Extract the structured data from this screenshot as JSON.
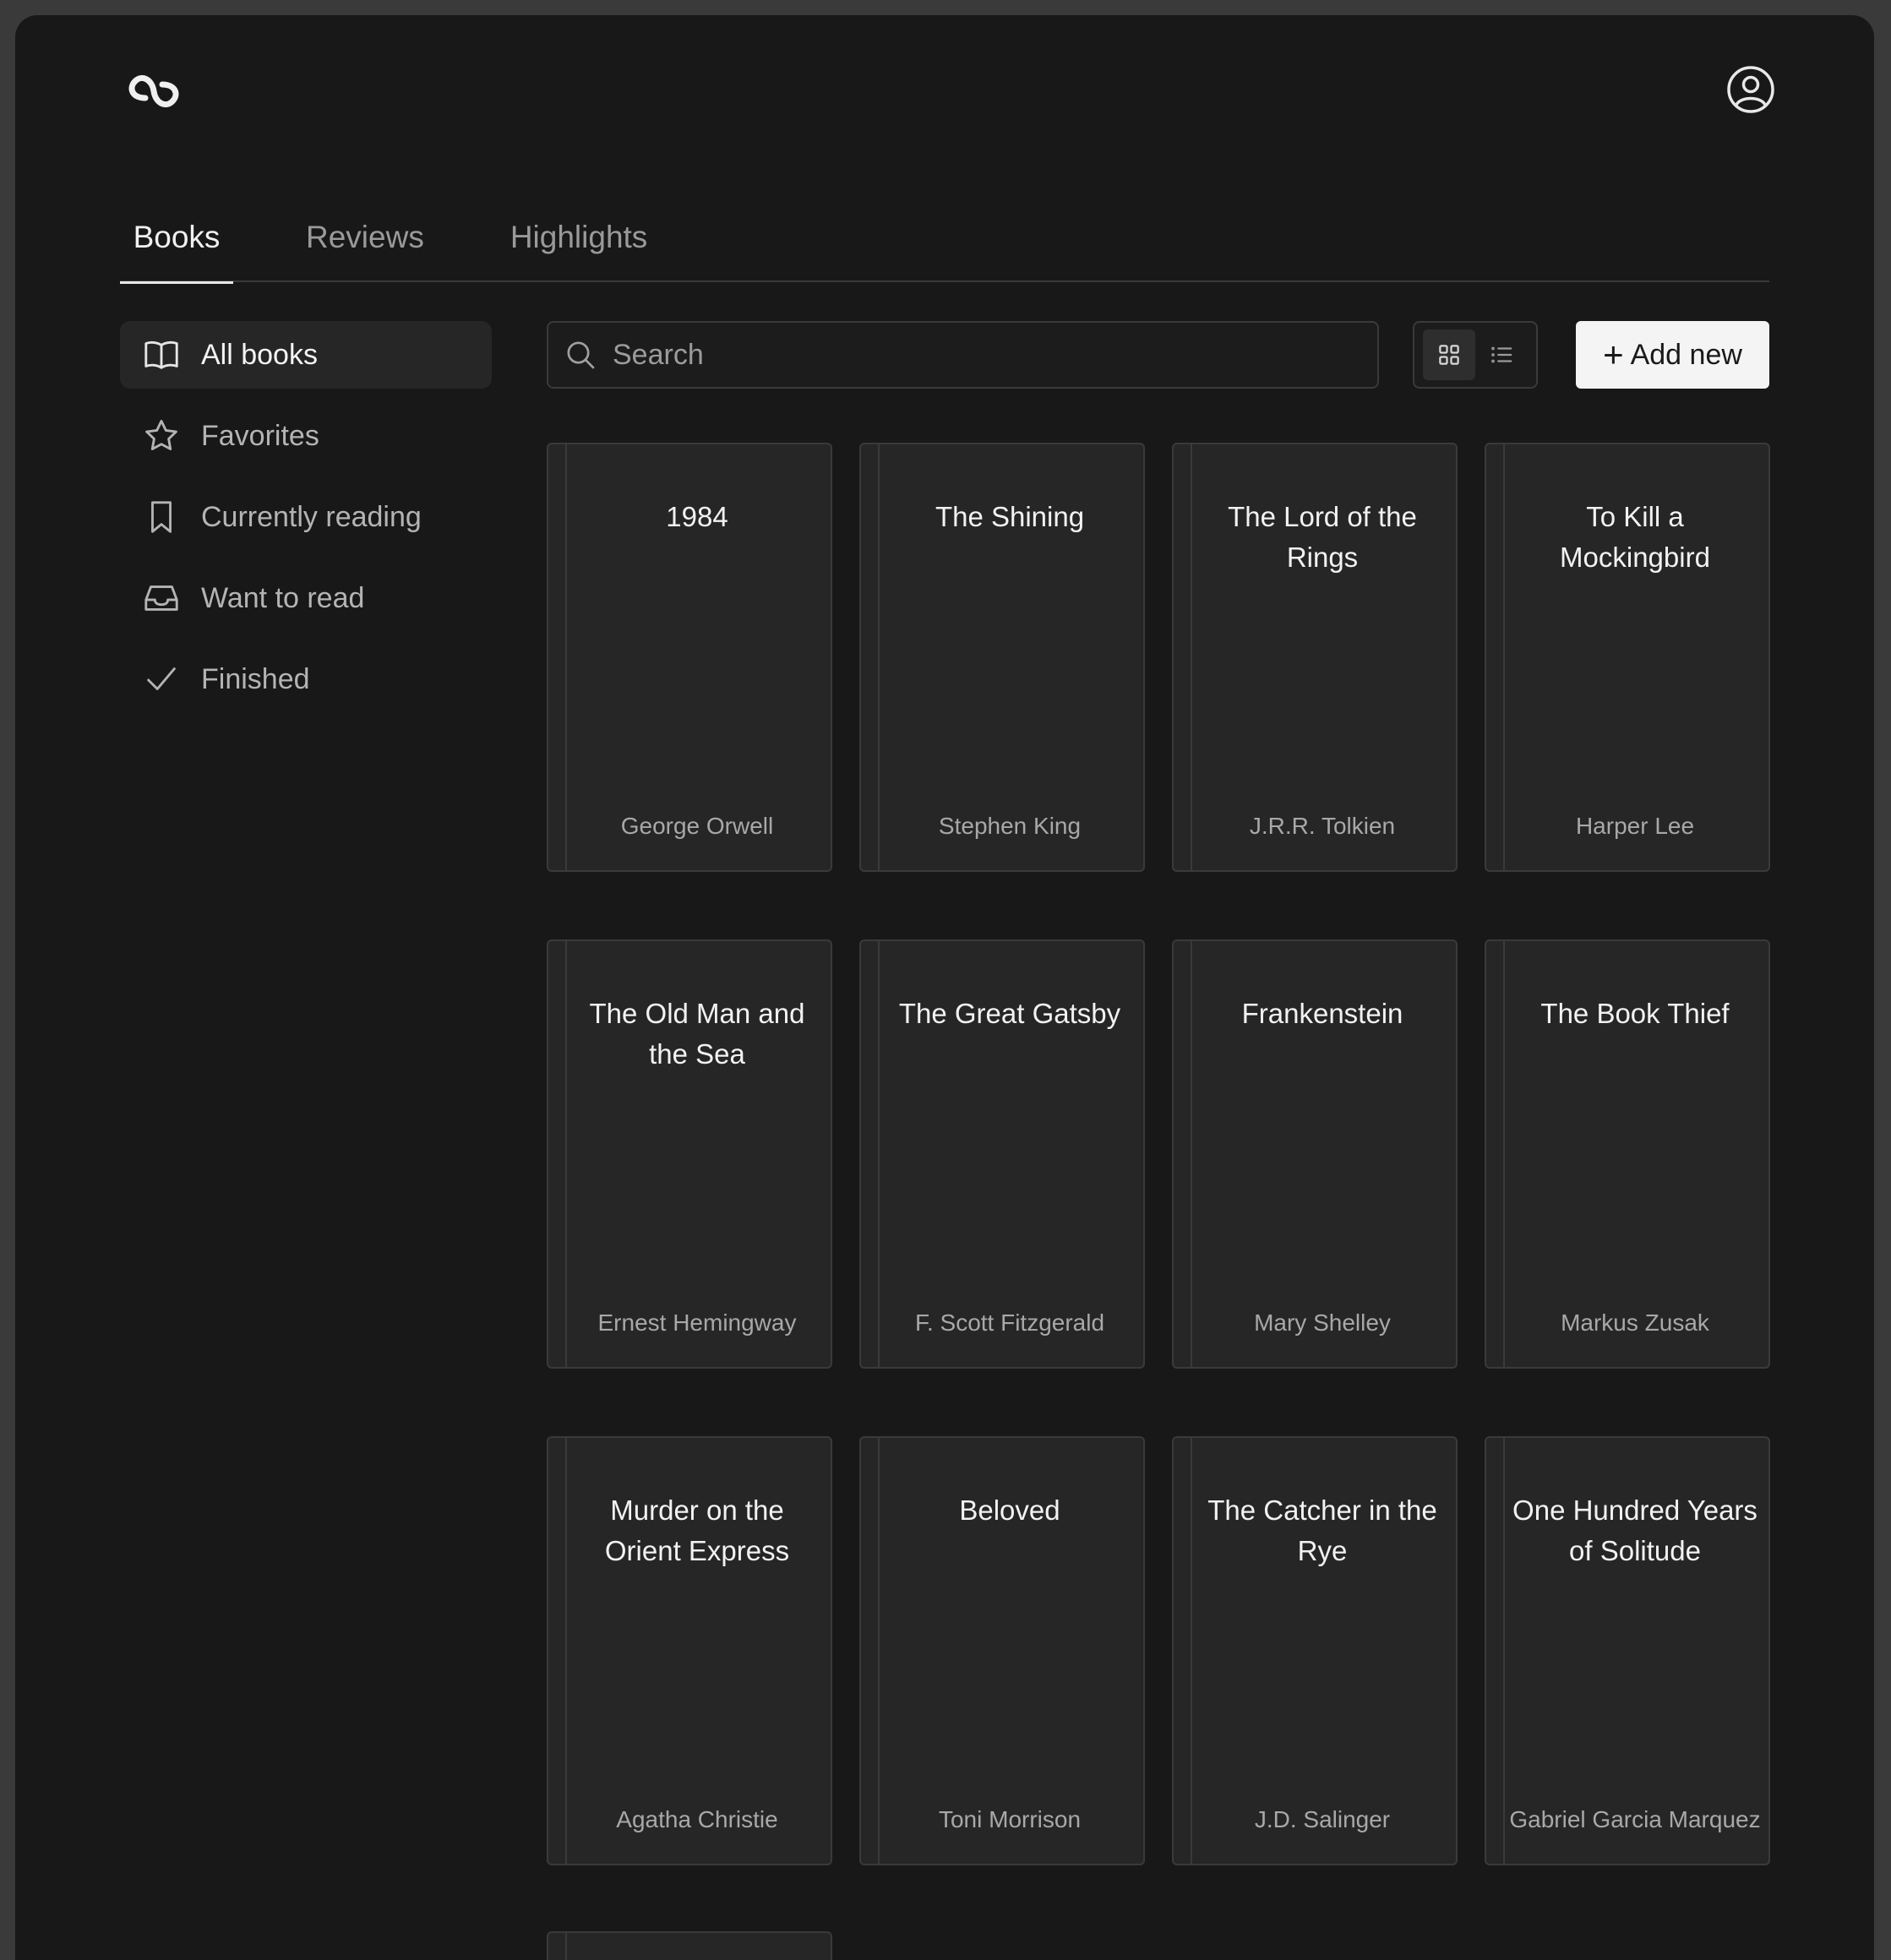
{
  "header": {
    "logo_icon": "swoosh-logo-icon",
    "account_icon": "user-circle-icon"
  },
  "tabs": [
    {
      "label": "Books",
      "active": true
    },
    {
      "label": "Reviews",
      "active": false
    },
    {
      "label": "Highlights",
      "active": false
    }
  ],
  "sidebar": {
    "items": [
      {
        "label": "All books",
        "icon": "open-book-icon",
        "active": true
      },
      {
        "label": "Favorites",
        "icon": "star-icon",
        "active": false
      },
      {
        "label": "Currently reading",
        "icon": "bookmark-icon",
        "active": false
      },
      {
        "label": "Want to read",
        "icon": "inbox-icon",
        "active": false
      },
      {
        "label": "Finished",
        "icon": "check-icon",
        "active": false
      }
    ]
  },
  "search": {
    "placeholder": "Search",
    "value": ""
  },
  "view_toggle": {
    "selected": "grid",
    "options": [
      "grid-icon",
      "list-icon"
    ]
  },
  "add_button": {
    "label": "Add new"
  },
  "books": [
    {
      "title": "1984",
      "author": "George Orwell"
    },
    {
      "title": "The Shining",
      "author": "Stephen King"
    },
    {
      "title": "The Lord of the Rings",
      "author": "J.R.R. Tolkien"
    },
    {
      "title": "To Kill a Mockingbird",
      "author": "Harper Lee"
    },
    {
      "title": "The Old Man and the Sea",
      "author": "Ernest Hemingway"
    },
    {
      "title": "The Great Gatsby",
      "author": "F. Scott Fitzgerald"
    },
    {
      "title": "Frankenstein",
      "author": "Mary Shelley"
    },
    {
      "title": "The Book Thief",
      "author": "Markus Zusak"
    },
    {
      "title": "Murder on the Orient Express",
      "author": "Agatha Christie"
    },
    {
      "title": "Beloved",
      "author": "Toni Morrison"
    },
    {
      "title": "The Catcher in the Rye",
      "author": "J.D. Salinger"
    },
    {
      "title": "One Hundred Years of Solitude",
      "author": "Gabriel Garcia Marquez"
    }
  ]
}
